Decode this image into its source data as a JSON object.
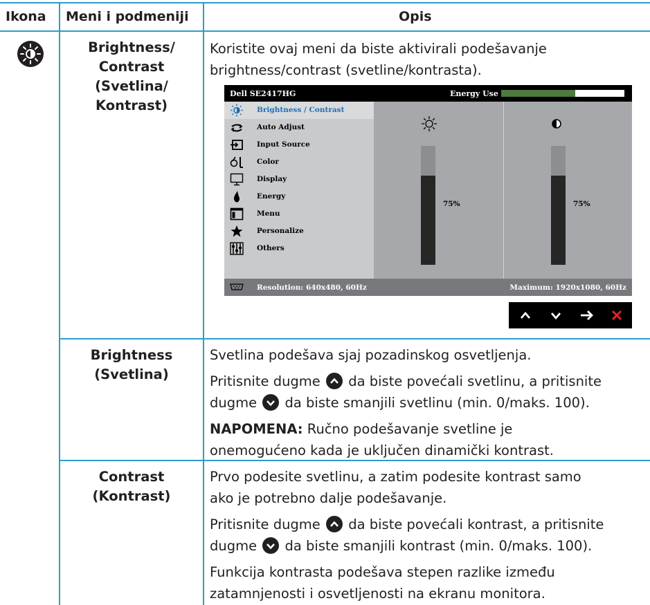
{
  "header": {
    "col1": "Ikona",
    "col2": "Meni i podmeniji",
    "col3": "Opis"
  },
  "row1": {
    "menu": [
      "Brightness/",
      "Contrast",
      "(Svetlina/",
      "Kontrast)"
    ],
    "desc": [
      "Koristite ovaj meni da biste aktivirali podešavanje",
      "brightness/contrast (svetline/kontrasta)."
    ]
  },
  "osd": {
    "model": "Dell SE2417HG",
    "energy_label": "Energy Use",
    "energy_level": 0.6,
    "items": [
      {
        "label": "Brightness / Contrast",
        "icon": "brightness-icon",
        "selected": true
      },
      {
        "label": "Auto Adjust",
        "icon": "auto-adjust-icon"
      },
      {
        "label": "Input Source",
        "icon": "input-source-icon"
      },
      {
        "label": "Color",
        "icon": "color-icon"
      },
      {
        "label": "Display",
        "icon": "display-icon"
      },
      {
        "label": "Energy",
        "icon": "energy-icon"
      },
      {
        "label": "Menu",
        "icon": "menu-icon"
      },
      {
        "label": "Personalize",
        "icon": "star-icon"
      },
      {
        "label": "Others",
        "icon": "others-icon"
      }
    ],
    "brightness_pct": "75%",
    "brightness_level": 0.75,
    "contrast_pct": "75%",
    "contrast_level": 0.75,
    "resolution": "Resolution: 640x480, 60Hz",
    "maximum": "Maximum: 1920x1080, 60Hz"
  },
  "row2": {
    "menu": [
      "Brightness",
      "(Svetlina)"
    ],
    "p1": "Svetlina podešava sjaj pozadinskog osvetljenja.",
    "p2a": "Pritisnite dugme",
    "p2b": "da biste povećali svetlinu, a pritisnite",
    "p2c": "dugme",
    "p2d": "da biste smanjili svetlinu (min. 0/maks. 100).",
    "note_label": "NAPOMENA:",
    "note_a": "Ručno podešavanje svetline je",
    "note_b": "onemogućeno kada je uključen dinamički kontrast."
  },
  "row3": {
    "menu": [
      "Contrast",
      "(Kontrast)"
    ],
    "p1a": "Prvo podesite svetlinu, a zatim podesite kontrast samo",
    "p1b": "ako je potrebno dalje podešavanje.",
    "p2a": "Pritisnite dugme",
    "p2b": "da biste povećali kontrast, a pritisnite",
    "p2c": "dugme",
    "p2d": "da biste smanjili kontrast (min. 0/maks. 100).",
    "p3a": "Funkcija kontrasta podešava stepen razlike između",
    "p3b": "zatamnjenosti i osvetljenosti na ekranu monitora."
  }
}
